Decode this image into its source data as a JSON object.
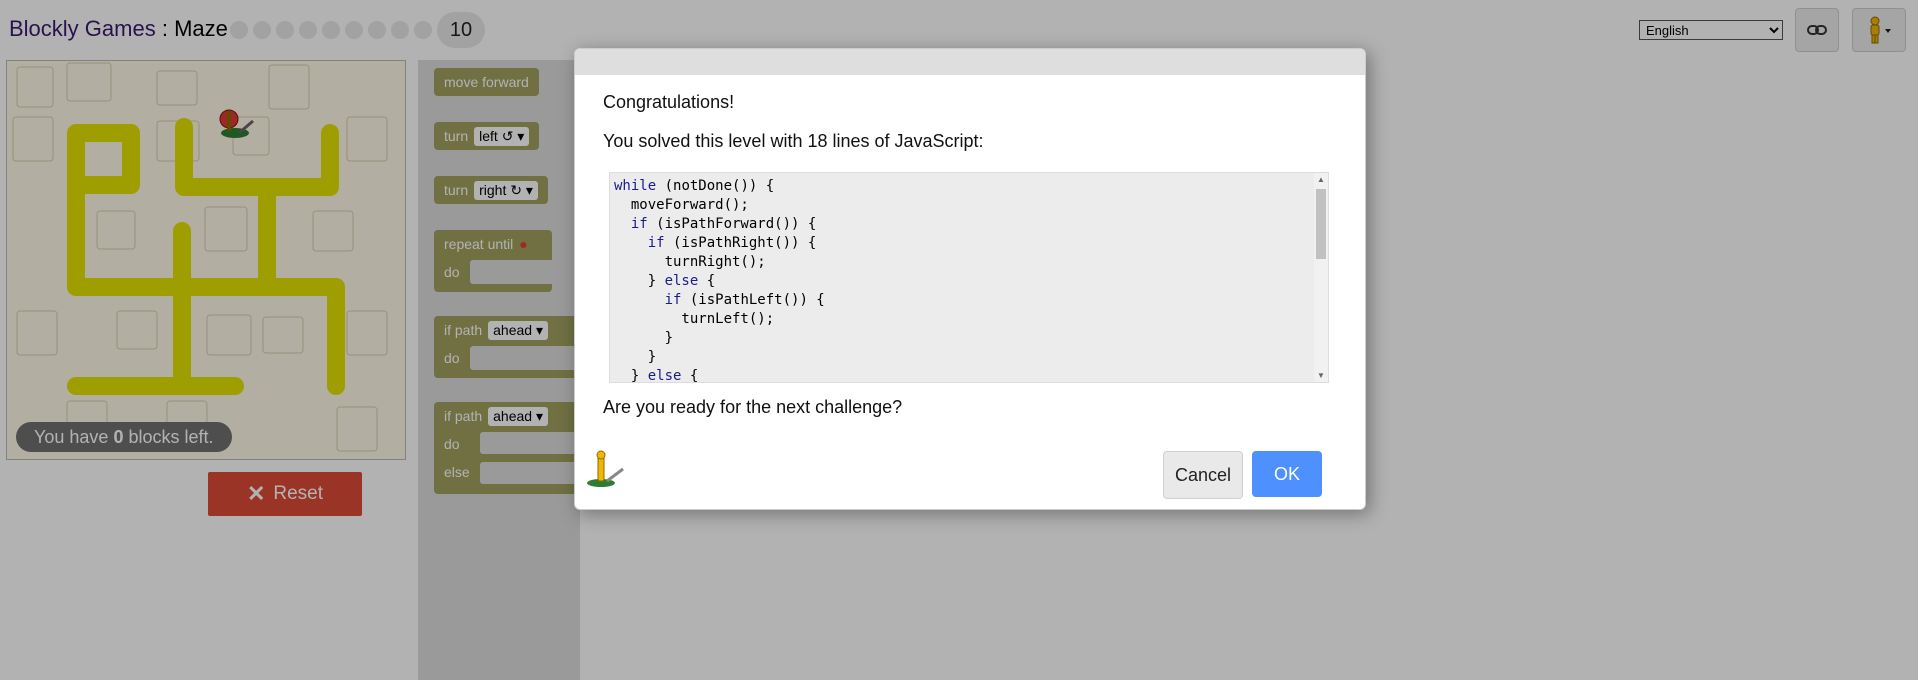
{
  "header": {
    "app_name": "Blockly Games",
    "separator": " : ",
    "game_name": "Maze",
    "current_level": "10",
    "language_selected": "English"
  },
  "maze": {
    "blocks_left_prefix": "You have ",
    "blocks_left_count": "0",
    "blocks_left_suffix": " blocks left.",
    "reset_label": "Reset"
  },
  "toolbox": {
    "move_forward": "move forward",
    "turn_label": "turn",
    "turn_left_value": "left ↺",
    "turn_right_value": "right ↻",
    "repeat_until": "repeat until",
    "do_label": "do",
    "if_path": "if path",
    "ahead_value": "ahead",
    "else_label": "else"
  },
  "dialog": {
    "congrats": "Congratulations!",
    "solved_text": "You solved this level with 18 lines of JavaScript:",
    "code_lines": [
      "while (notDone()) {",
      "  moveForward();",
      "  if (isPathForward()) {",
      "    if (isPathRight()) {",
      "      turnRight();",
      "    } else {",
      "      if (isPathLeft()) {",
      "        turnLeft();",
      "      }",
      "    }",
      "  } else {"
    ],
    "question": "Are you ready for the next challenge?",
    "cancel_label": "Cancel",
    "ok_label": "OK"
  },
  "colors": {
    "path": "#e0e000",
    "reset": "#dd4b39",
    "ok": "#4d90fe",
    "block": "#a1a160"
  },
  "icons": [
    "link-icon",
    "pegman-icon",
    "finish-marker-icon",
    "reset-x-icon"
  ]
}
